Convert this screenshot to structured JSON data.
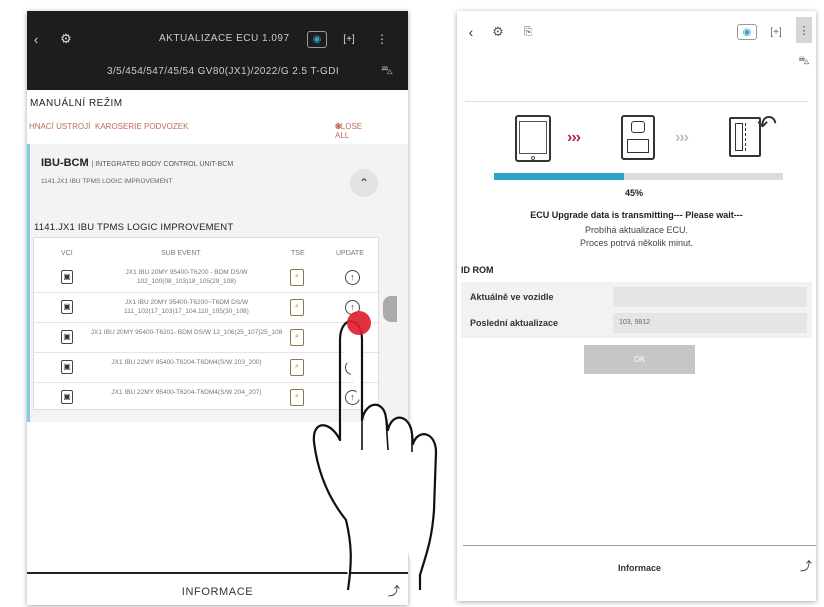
{
  "left_panel": {
    "header": {
      "title": "AKTUALIZACE ECU 1.097",
      "vehicle": "3/5/454/547/45/54 GV80(JX1)/2022/G 2.5 T-GDI"
    },
    "mode_title": "MANUÁLNÍ REŽIM",
    "filters": [
      "HNACÍ ÚSTROJÍ",
      "KAROSERIE",
      "PODVOZEK"
    ],
    "close_all": "CLOSE ALL",
    "ecu": {
      "code": "IBU-BCM",
      "name": "INTEGRATED BODY CONTROL UNIT-BCM",
      "subname": "1141.JX1 IBU TPMS LOGIC IMPROVEMENT",
      "event_title": "1141.JX1 IBU TPMS LOGIC IMPROVEMENT",
      "columns": {
        "vci": "VCI",
        "sub_event": "SUB EVENT",
        "tse": "TSE",
        "update": "UPDATE"
      },
      "rows": [
        {
          "text": "JX1 IBU 20MY 95400-T6200 - BDM DS/W 102_100(08_103)18_105(29_108)"
        },
        {
          "text": "JX1 IBU 20MY 95400-T6200~T6DM DS/W 111_102(17_103)17_104.110_105(30_108)"
        },
        {
          "text": "JX1 IBU 20MY 95400-T6201- BDM DS/W 12_106(25_107)25_108"
        },
        {
          "text": "JX1 IBU 22MY 95400-T6204-T6DM4(S/W 203_200)"
        },
        {
          "text": "JX1 IBU 22MY 95400-T6204-T6DM4(S/W 204_207)"
        }
      ]
    },
    "footer": "INFORMACE"
  },
  "right_panel": {
    "progress": {
      "percent": 45,
      "label": "45%"
    },
    "messages": {
      "line1": "ECU Upgrade data is transmitting--- Please wait---",
      "line2": "Probíhá aktualizace ECU.",
      "line3": "Proces potrvá několik minut."
    },
    "id_rom": {
      "title": "ID ROM",
      "rows": [
        {
          "key": "Aktuálně ve vozidle",
          "value": ""
        },
        {
          "key": "Poslední aktualizace",
          "value": "103, 9812"
        }
      ]
    },
    "ok_label": "OK",
    "footer": "Informace"
  },
  "colors": {
    "progress": "#2aa6c5",
    "accent_red": "#b3243c",
    "touch": "#e0202f"
  }
}
